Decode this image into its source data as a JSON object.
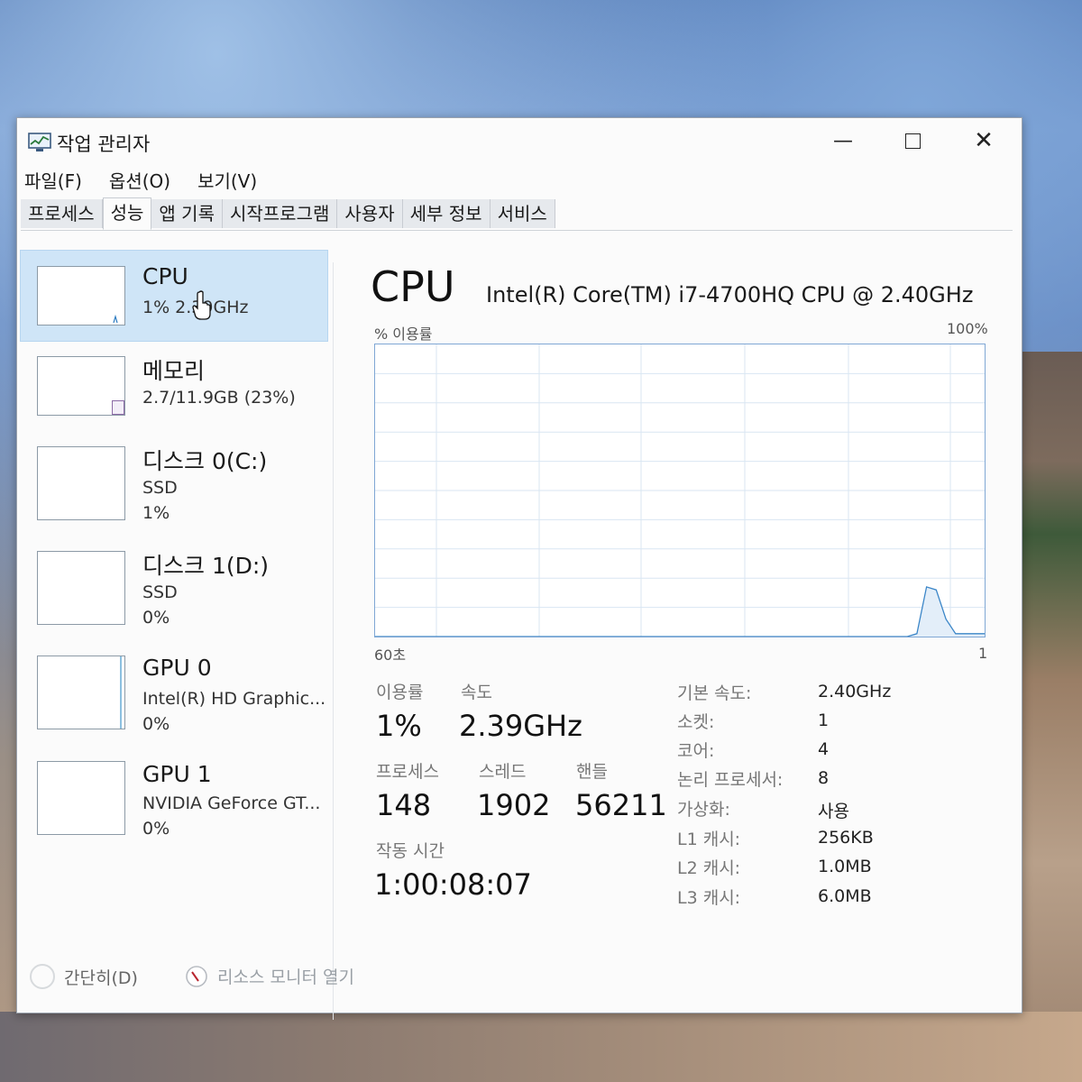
{
  "window": {
    "title": "작업 관리자"
  },
  "menu": [
    "파일(F)",
    "옵션(O)",
    "보기(V)"
  ],
  "tabs": [
    "프로세스",
    "성능",
    "앱 기록",
    "시작프로그램",
    "사용자",
    "세부 정보",
    "서비스"
  ],
  "active_tab": "성능",
  "sidebar": {
    "cpu": {
      "title": "CPU",
      "detail": "1% 2.39GHz"
    },
    "memory": {
      "title": "메모리",
      "detail": "2.7/11.9GB (23%)"
    },
    "disk0": {
      "title": "디스크 0(C:)",
      "type": "SSD",
      "usage": "1%"
    },
    "disk1": {
      "title": "디스크 1(D:)",
      "type": "SSD",
      "usage": "0%"
    },
    "gpu0": {
      "title": "GPU 0",
      "name": "Intel(R) HD Graphic...",
      "usage": "0%"
    },
    "gpu1": {
      "title": "GPU 1",
      "name": "NVIDIA GeForce GT...",
      "usage": "0%"
    }
  },
  "main": {
    "title": "CPU",
    "cpu_name": "Intel(R) Core(TM) i7-4700HQ CPU @ 2.40GHz",
    "graph": {
      "ylabel": "% 이용률",
      "ymax_label": "100%",
      "xleft_label": "60초",
      "xright_label": "1"
    },
    "stats": {
      "usage_label": "이용률",
      "usage": "1%",
      "speed_label": "속도",
      "speed": "2.39GHz",
      "processes_label": "프로세스",
      "processes": "148",
      "threads_label": "스레드",
      "threads": "1902",
      "handles_label": "핸들",
      "handles": "56211",
      "uptime_label": "작동 시간",
      "uptime": "1:00:08:07"
    },
    "specs": [
      {
        "label": "기본 속도:",
        "value": "2.40GHz"
      },
      {
        "label": "소켓:",
        "value": "1"
      },
      {
        "label": "코어:",
        "value": "4"
      },
      {
        "label": "논리 프로세서:",
        "value": "8"
      },
      {
        "label": "가상화:",
        "value": "사용"
      },
      {
        "label": "L1 캐시:",
        "value": "256KB"
      },
      {
        "label": "L2 캐시:",
        "value": "1.0MB"
      },
      {
        "label": "L3 캐시:",
        "value": "6.0MB"
      }
    ]
  },
  "footer": {
    "fewer_details": "간단히(D)",
    "resource_monitor": "리소스 모니터 열기"
  },
  "chart_data": {
    "type": "area",
    "ylabel": "% 이용률",
    "ylim": [
      0,
      100
    ],
    "xlabel": "",
    "x_range_seconds": [
      60,
      0
    ],
    "values": [
      0,
      0,
      0,
      0,
      0,
      0,
      0,
      0,
      0,
      0,
      0,
      0,
      0,
      0,
      0,
      0,
      0,
      0,
      0,
      0,
      0,
      0,
      0,
      0,
      0,
      0,
      0,
      0,
      0,
      0,
      0,
      0,
      0,
      0,
      0,
      0,
      0,
      0,
      0,
      0,
      0,
      0,
      0,
      0,
      0,
      0,
      0,
      0,
      0,
      0,
      0,
      0,
      0,
      0,
      0,
      0,
      1,
      17,
      16,
      6,
      1,
      1,
      1,
      1
    ]
  }
}
